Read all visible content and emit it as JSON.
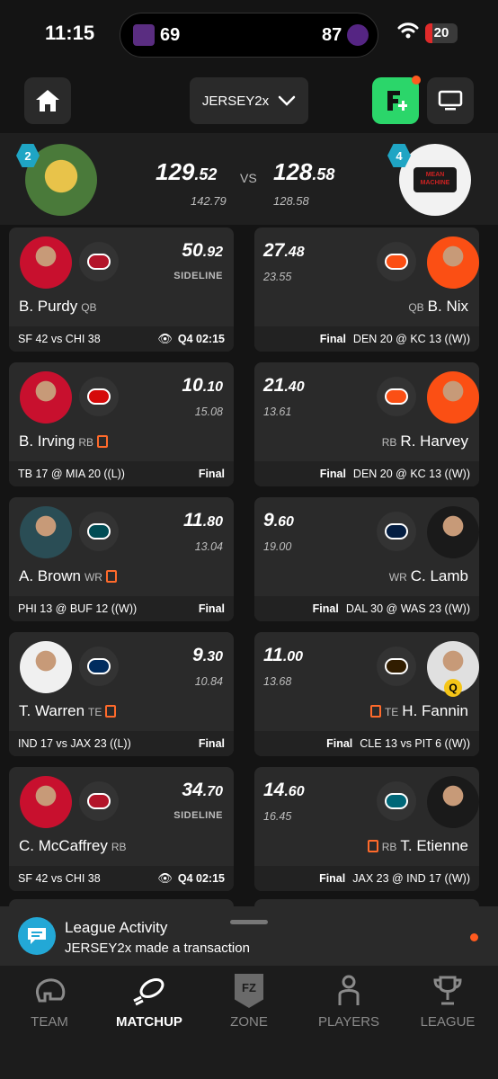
{
  "status_bar": {
    "time": "11:15",
    "home_score": "69",
    "away_score": "87",
    "battery": "20"
  },
  "nav": {
    "team_select": "JERSEY2x"
  },
  "matchup": {
    "left": {
      "rank": "2",
      "score_main": "129",
      "score_dec": ".52",
      "projected": "142.79"
    },
    "vs": "VS",
    "right": {
      "rank": "4",
      "score_main": "128",
      "score_dec": ".58",
      "projected": "128.58",
      "logo_text": "MEAN MACHINE"
    }
  },
  "cards": [
    {
      "side": "left",
      "name": "B. Purdy",
      "pos": "QB",
      "pts_main": "50",
      "pts_dec": ".92",
      "sub": "SIDELINE",
      "game": "SF 42 vs CHI 38",
      "status": "Q4 02:15",
      "live": true,
      "news": false,
      "team": "SF"
    },
    {
      "side": "right",
      "name": "B. Nix",
      "pos": "QB",
      "pts_main": "27",
      "pts_dec": ".48",
      "sub": "23.55",
      "game": "DEN 20 @ KC 13 ((W))",
      "status": "Final",
      "news": false,
      "team": "DEN"
    },
    {
      "side": "left",
      "name": "B. Irving",
      "pos": "RB",
      "pts_main": "10",
      "pts_dec": ".10",
      "sub": "15.08",
      "game": "TB 17 @ MIA 20 ((L))",
      "status": "Final",
      "news": true,
      "team": "TB"
    },
    {
      "side": "right",
      "name": "R. Harvey",
      "pos": "RB",
      "pts_main": "21",
      "pts_dec": ".40",
      "sub": "13.61",
      "game": "DEN 20 @ KC 13 ((W))",
      "status": "Final",
      "news": false,
      "team": "DEN"
    },
    {
      "side": "left",
      "name": "A. Brown",
      "pos": "WR",
      "pts_main": "11",
      "pts_dec": ".80",
      "sub": "13.04",
      "game": "PHI 13 @ BUF 12 ((W))",
      "status": "Final",
      "news": true,
      "team": "PHI"
    },
    {
      "side": "right",
      "name": "C. Lamb",
      "pos": "WR",
      "pts_main": "9",
      "pts_dec": ".60",
      "sub": "19.00",
      "game": "DAL 30 @ WAS 23 ((W))",
      "status": "Final",
      "news": false,
      "team": "DAL"
    },
    {
      "side": "left",
      "name": "T. Warren",
      "pos": "TE",
      "pts_main": "9",
      "pts_dec": ".30",
      "sub": "10.84",
      "game": "IND 17 vs JAX 23 ((L))",
      "status": "Final",
      "news": true,
      "team": "IND"
    },
    {
      "side": "right",
      "name": "H. Fannin",
      "pos": "TE",
      "pts_main": "11",
      "pts_dec": ".00",
      "sub": "13.68",
      "game": "CLE 13 vs PIT 6 ((W))",
      "status": "Final",
      "news": true,
      "team": "CLE",
      "badge": "Q"
    },
    {
      "side": "left",
      "name": "C. McCaffrey",
      "pos": "RB",
      "pts_main": "34",
      "pts_dec": ".70",
      "sub": "SIDELINE",
      "game": "SF 42 vs CHI 38",
      "status": "Q4 02:15",
      "live": true,
      "news": false,
      "team": "SF"
    },
    {
      "side": "right",
      "name": "T. Etienne",
      "pos": "RB",
      "pts_main": "14",
      "pts_dec": ".60",
      "sub": "16.45",
      "game": "JAX 23 @ IND 17 ((W))",
      "status": "Final",
      "news": true,
      "team": "JAX"
    }
  ],
  "activity": {
    "title": "League Activity",
    "message": "JERSEY2x made a transaction"
  },
  "tabs": [
    {
      "label": "TEAM",
      "icon": "helmet-icon",
      "active": false
    },
    {
      "label": "MATCHUP",
      "icon": "football-icon",
      "active": true
    },
    {
      "label": "ZONE",
      "icon": "fz-shield-icon",
      "active": false
    },
    {
      "label": "PLAYERS",
      "icon": "person-icon",
      "active": false
    },
    {
      "label": "LEAGUE",
      "icon": "trophy-icon",
      "active": false
    }
  ],
  "colors": {
    "accent_green": "#2bd66a",
    "notify_orange": "#ff5a1f",
    "rank_teal": "#1fa5c4",
    "news_orange": "#ff6a2b"
  }
}
